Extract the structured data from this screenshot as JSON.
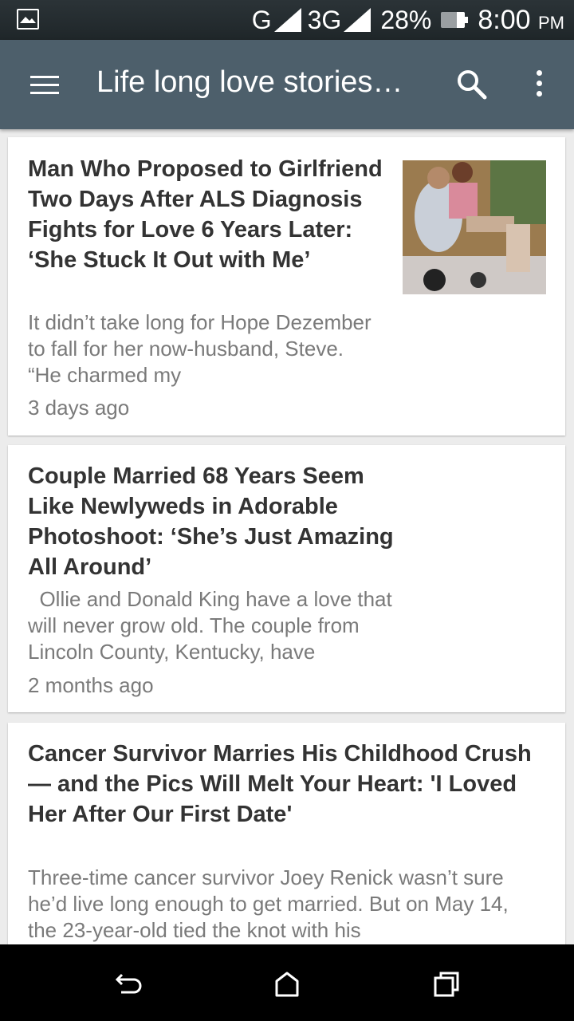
{
  "status_bar": {
    "network_1": "G",
    "network_2": "3G",
    "battery_percent": "28%",
    "time": "8:00",
    "ampm": "PM",
    "icons": [
      "gallery-icon",
      "signal-icon",
      "battery-icon"
    ]
  },
  "app_bar": {
    "title": "Life long love stories…",
    "icons": [
      "menu-icon",
      "search-icon",
      "more-vert-icon"
    ]
  },
  "articles": [
    {
      "headline": "Man Who Proposed to Girlfriend Two Days After ALS Diagnosis Fights for Love 6 Years Later: ‘She Stuck It Out with Me’",
      "snippet": "It didn’t take long for Hope Dezember to fall for her now-husband, Steve. “He charmed my",
      "age": "3 days ago"
    },
    {
      "headline": "Couple Married 68 Years Seem Like Newlyweds in Adorable Photoshoot: ‘She’s Just Amazing All Around’",
      "snippet": "  Ollie and Donald King have a love that will never grow old. The couple from Lincoln County, Kentucky, have",
      "age": "2 months ago"
    },
    {
      "headline": "Cancer Survivor Marries His Childhood Crush — and the Pics Will Melt Your Heart: 'I Loved Her After Our First Date'",
      "snippet": "Three-time cancer survivor Joey Renick wasn’t sure he’d live long enough to get married. But on May 14, the 23-year-old tied the knot with his",
      "age": ""
    }
  ],
  "nav_bar": {
    "icons": [
      "back-icon",
      "home-icon",
      "recents-icon"
    ]
  }
}
